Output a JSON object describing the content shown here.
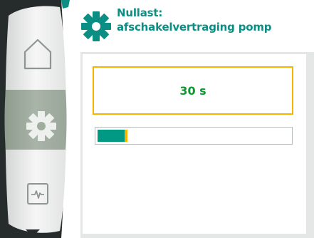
{
  "header": {
    "icon": "gear-icon",
    "title_line1": "Nullast:",
    "title_line2": "afschakelvertraging pomp"
  },
  "nav": {
    "items": [
      {
        "icon": "home-icon",
        "selected": false
      },
      {
        "icon": "gear-icon",
        "selected": true
      },
      {
        "icon": "monitor-icon",
        "selected": false
      }
    ],
    "more_indicator": "chevron-down-icon"
  },
  "setting": {
    "value_text": "30 s",
    "progress_fraction": 0.14
  },
  "colors": {
    "accent_teal": "#0b8f84",
    "value_green": "#0b9a2e",
    "focus_yellow": "#f5b400",
    "progress_fill": "#009a84",
    "rail_selected": "#9fac9e"
  }
}
